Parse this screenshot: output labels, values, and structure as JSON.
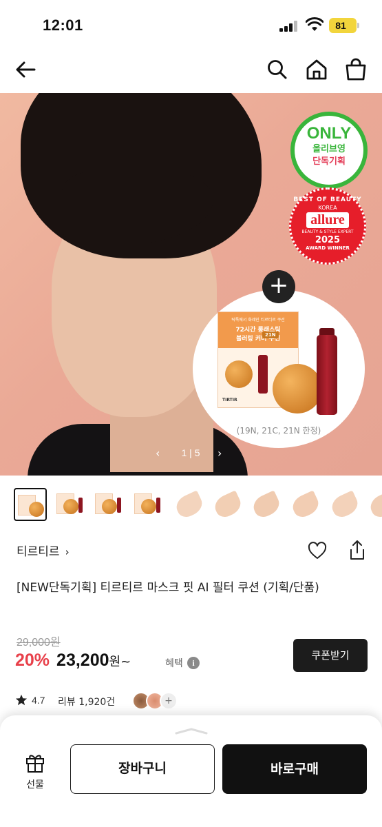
{
  "status_bar": {
    "time": "12:01",
    "battery": "81"
  },
  "nav": {
    "back_icon": "arrow-left-icon",
    "search_icon": "search-icon",
    "home_icon": "home-icon",
    "bag_icon": "shopping-bag-icon"
  },
  "hero": {
    "badge_only": {
      "title": "ONLY",
      "line1": "올리브영",
      "line2": "단독기획"
    },
    "badge_award": {
      "top": "BEST OF BEAUTY",
      "korea": "KOREA",
      "logo": "allure",
      "expert": "BEAUTY & STYLE EXPERT",
      "year": "2025",
      "bottom": "AWARD WINNER"
    },
    "plus": "+",
    "bundle": {
      "small_text": "틱톡에서 화제인 티르티르 쿠션",
      "line1": "72시간 롱래스팅",
      "line2": "블러링 커버 쿠션",
      "tag": "21N",
      "logo": "TIRTIR",
      "caption": "(19N, 21C, 21N 한정)"
    },
    "pager": {
      "current": "1",
      "separator": "|",
      "total": "5",
      "prev": "‹",
      "next": "›"
    }
  },
  "thumbnails": {
    "count": 10,
    "active_index": 0
  },
  "product": {
    "brand": "티르티르",
    "brand_arrow": "›",
    "title": "[NEW단독기획] 티르티르 마스크 핏 AI 필터 쿠션 (기획/단품)",
    "original_price": "29,000원",
    "discount": "20%",
    "price": "23,200",
    "price_unit": "원~",
    "benefit_label": "혜택",
    "benefit_icon": "i",
    "coupon_button": "쿠폰받기",
    "rating": "4.7",
    "review_count": "리뷰 1,920건",
    "avatar_more": "+"
  },
  "bottom_bar": {
    "gift_label": "선물",
    "cart_button": "장바구니",
    "buy_button": "바로구매"
  },
  "colors": {
    "accent_red": "#e8404a",
    "olive_green": "#39b53b",
    "allure_red": "#e61e2a",
    "dark": "#111111"
  }
}
